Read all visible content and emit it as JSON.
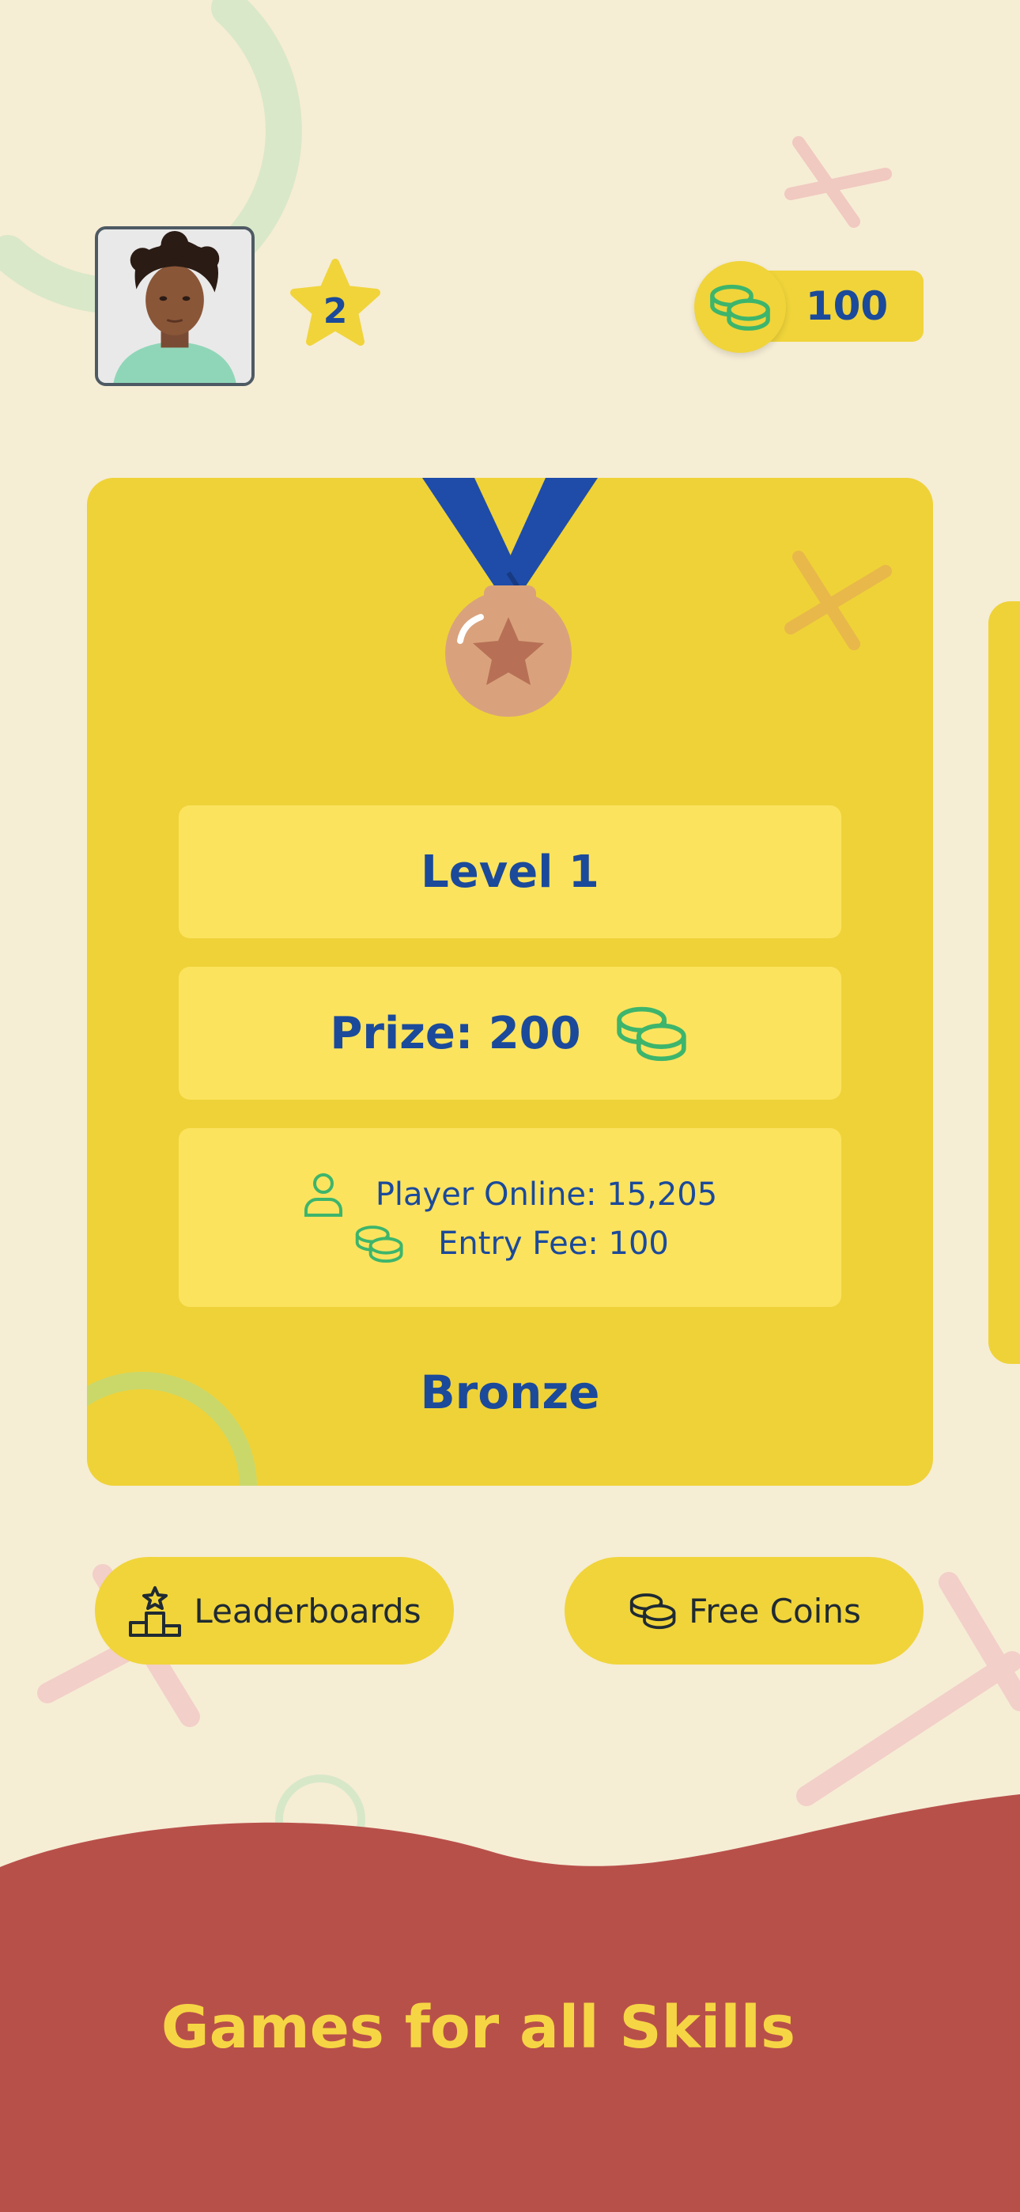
{
  "colors": {
    "background": "#F6EDD5",
    "card": "#EFD238",
    "info_box": "#FCE35E",
    "primary_text": "#1B4A9B",
    "coin_green": "#3DB56C",
    "footer": "#B8504A",
    "tagline": "#F6D544"
  },
  "header": {
    "avatar_icon": "user-photo",
    "level": "2",
    "coins": "100",
    "coins_icon": "coins-icon"
  },
  "card": {
    "medal_icon": "bronze-medal-icon",
    "level_label": "Level 1",
    "prize_label": "Prize: 200",
    "prize_icon": "coins-icon",
    "players_online": "Player Online: 15,205",
    "entry_fee": "Entry Fee: 100",
    "tier_name": "Bronze"
  },
  "actions": {
    "leaderboards_label": "Leaderboards",
    "leaderboards_icon": "podium-icon",
    "free_coins_label": "Free Coins",
    "free_coins_icon": "coins-icon"
  },
  "footer": {
    "tagline": "Games for all Skills"
  }
}
